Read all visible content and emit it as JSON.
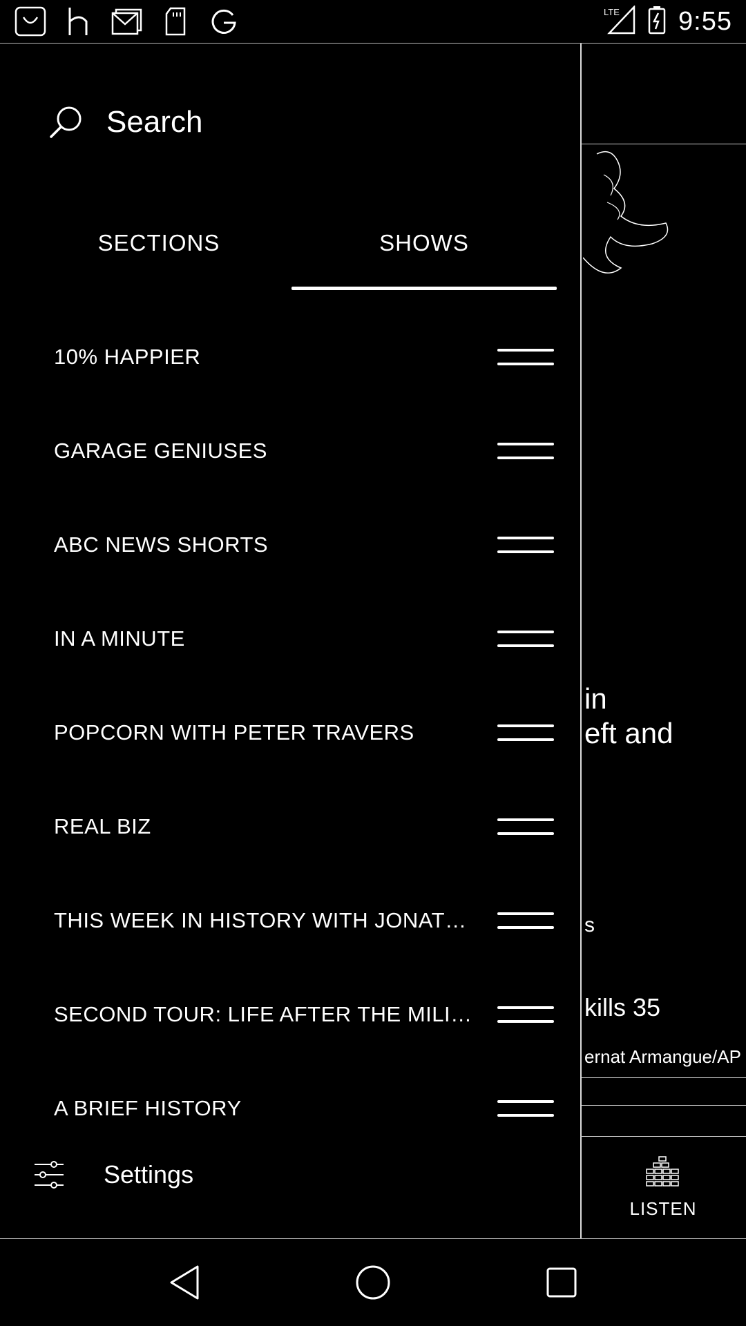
{
  "status_bar": {
    "time": "9:55",
    "left_icons": [
      "app-u-icon",
      "houzz-icon",
      "gmail-icon",
      "sd-card-icon",
      "google-icon"
    ],
    "right_icons": [
      "lte-signal-icon",
      "battery-charging-icon"
    ]
  },
  "drawer": {
    "search_label": "Search",
    "tabs": [
      {
        "label": "SECTIONS",
        "selected": false
      },
      {
        "label": "SHOWS",
        "selected": true
      }
    ],
    "shows": [
      {
        "title": "10% HAPPIER"
      },
      {
        "title": "GARAGE GENIUSES"
      },
      {
        "title": "ABC NEWS SHORTS"
      },
      {
        "title": "IN A MINUTE"
      },
      {
        "title": "POPCORN WITH PETER TRAVERS"
      },
      {
        "title": "REAL BIZ"
      },
      {
        "title": "THIS WEEK IN HISTORY WITH JONATH..."
      },
      {
        "title": "SECOND TOUR: LIFE AFTER THE MILIT..."
      },
      {
        "title": "A BRIEF HISTORY"
      }
    ],
    "settings_label": "Settings"
  },
  "background_article": {
    "headline_line1": "in",
    "headline_line2": "eft and",
    "snippet_1": "s",
    "snippet_2": "kills 35",
    "photo_credit": "ernat Armangue/AP",
    "listen_label": "LISTEN"
  }
}
